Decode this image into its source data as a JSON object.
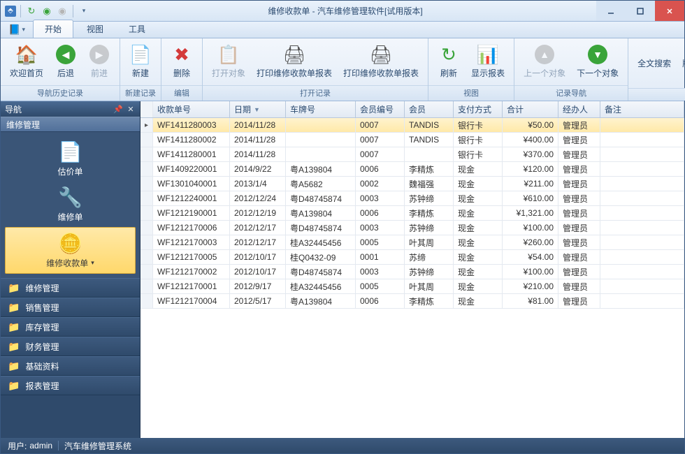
{
  "window": {
    "title": "维修收款单 - 汽车维修管理软件[试用版本]"
  },
  "menutabs": [
    "开始",
    "视图",
    "工具"
  ],
  "ribbon": {
    "groups": [
      {
        "label": "导航历史记录",
        "items": [
          {
            "key": "home",
            "label": "欢迎首页",
            "ico": "🏠",
            "color": "#e07b2e"
          },
          {
            "key": "back",
            "label": "后退",
            "ico": "◀",
            "color": "#3aa43a",
            "circle": true
          },
          {
            "key": "fwd",
            "label": "前进",
            "ico": "▶",
            "color": "#999",
            "circle": true,
            "disabled": true
          }
        ]
      },
      {
        "label": "新建记录",
        "items": [
          {
            "key": "new",
            "label": "新建",
            "ico": "📄",
            "color": "#6aa2e0"
          }
        ]
      },
      {
        "label": "编辑",
        "items": [
          {
            "key": "del",
            "label": "删除",
            "ico": "✖",
            "color": "#d43a3a"
          }
        ]
      },
      {
        "label": "打开记录",
        "items": [
          {
            "key": "open",
            "label": "打开对象",
            "ico": "📋",
            "color": "#999",
            "disabled": true
          },
          {
            "key": "print1",
            "label": "打印维修收款单报表",
            "ico": "🖨",
            "color": "#555"
          },
          {
            "key": "print2",
            "label": "打印维修收款单报表",
            "ico": "🖨",
            "color": "#555"
          }
        ]
      },
      {
        "label": "视图",
        "items": [
          {
            "key": "refresh",
            "label": "刷新",
            "ico": "↻",
            "color": "#3aa43a",
            "circle": false
          },
          {
            "key": "showrep",
            "label": "显示报表",
            "ico": "📊",
            "color": "#e0a23a"
          }
        ]
      },
      {
        "label": "记录导航",
        "items": [
          {
            "key": "prev",
            "label": "上一个对象",
            "ico": "▲",
            "color": "#999",
            "circle": true,
            "disabled": true
          },
          {
            "key": "next",
            "label": "下一个对象",
            "ico": "▼",
            "color": "#3aa43a",
            "circle": true
          }
        ]
      },
      {
        "label": "",
        "items": [
          {
            "key": "search",
            "label": "全文搜索",
            "textonly": true
          },
          {
            "key": "ver",
            "label": "版本信息",
            "textonly": true
          }
        ]
      }
    ]
  },
  "nav": {
    "title": "导航",
    "subtitle": "维修管理",
    "tiles": [
      {
        "key": "估价单",
        "label": "估价单",
        "ico": "📄"
      },
      {
        "key": "维修单",
        "label": "维修单",
        "ico": "🔧"
      },
      {
        "key": "维修收款单",
        "label": "维修收款单",
        "ico": "🪙",
        "selected": true,
        "dropdown": true
      }
    ],
    "cats": [
      "维修管理",
      "销售管理",
      "库存管理",
      "财务管理",
      "基础资料",
      "报表管理"
    ]
  },
  "grid": {
    "columns": [
      "收款单号",
      "日期",
      "车牌号",
      "会员编号",
      "会员",
      "支付方式",
      "合计",
      "经办人",
      "备注"
    ],
    "sort_col": 1,
    "rows": [
      {
        "sel": true,
        "c": [
          "WF1411280003",
          "2014/11/28",
          "",
          "0007",
          "TANDIS",
          "银行卡",
          "¥50.00",
          "管理员",
          ""
        ]
      },
      {
        "c": [
          "WF1411280002",
          "2014/11/28",
          "",
          "0007",
          "TANDIS",
          "银行卡",
          "¥400.00",
          "管理员",
          ""
        ]
      },
      {
        "c": [
          "WF1411280001",
          "2014/11/28",
          "",
          "0007",
          "",
          "银行卡",
          "¥370.00",
          "管理员",
          ""
        ]
      },
      {
        "c": [
          "WF1409220001",
          "2014/9/22",
          "粤A139804",
          "0006",
          "李精炼",
          "现金",
          "¥120.00",
          "管理员",
          ""
        ]
      },
      {
        "c": [
          "WF1301040001",
          "2013/1/4",
          "粤A5682",
          "0002",
          "魏福强",
          "现金",
          "¥211.00",
          "管理员",
          ""
        ]
      },
      {
        "c": [
          "WF1212240001",
          "2012/12/24",
          "粤D48745874",
          "0003",
          "苏钟缔",
          "现金",
          "¥610.00",
          "管理员",
          ""
        ]
      },
      {
        "c": [
          "WF1212190001",
          "2012/12/19",
          "粤A139804",
          "0006",
          "李精炼",
          "现金",
          "¥1,321.00",
          "管理员",
          ""
        ]
      },
      {
        "c": [
          "WF1212170006",
          "2012/12/17",
          "粤D48745874",
          "0003",
          "苏钟缔",
          "现金",
          "¥100.00",
          "管理员",
          ""
        ]
      },
      {
        "c": [
          "WF1212170003",
          "2012/12/17",
          "桂A32445456",
          "0005",
          "叶其周",
          "现金",
          "¥260.00",
          "管理员",
          ""
        ]
      },
      {
        "c": [
          "WF1212170005",
          "2012/10/17",
          "桂Q0432-09",
          "0001",
          "苏缔",
          "现金",
          "¥54.00",
          "管理员",
          ""
        ]
      },
      {
        "c": [
          "WF1212170002",
          "2012/10/17",
          "粤D48745874",
          "0003",
          "苏钟缔",
          "现金",
          "¥100.00",
          "管理员",
          ""
        ]
      },
      {
        "c": [
          "WF1212170001",
          "2012/9/17",
          "桂A32445456",
          "0005",
          "叶其周",
          "现金",
          "¥210.00",
          "管理员",
          ""
        ]
      },
      {
        "c": [
          "WF1212170004",
          "2012/5/17",
          "粤A139804",
          "0006",
          "李精炼",
          "现金",
          "¥81.00",
          "管理员",
          ""
        ]
      }
    ]
  },
  "status": {
    "user_label": "用户:",
    "user": "admin",
    "app": "汽车维修管理系统"
  }
}
